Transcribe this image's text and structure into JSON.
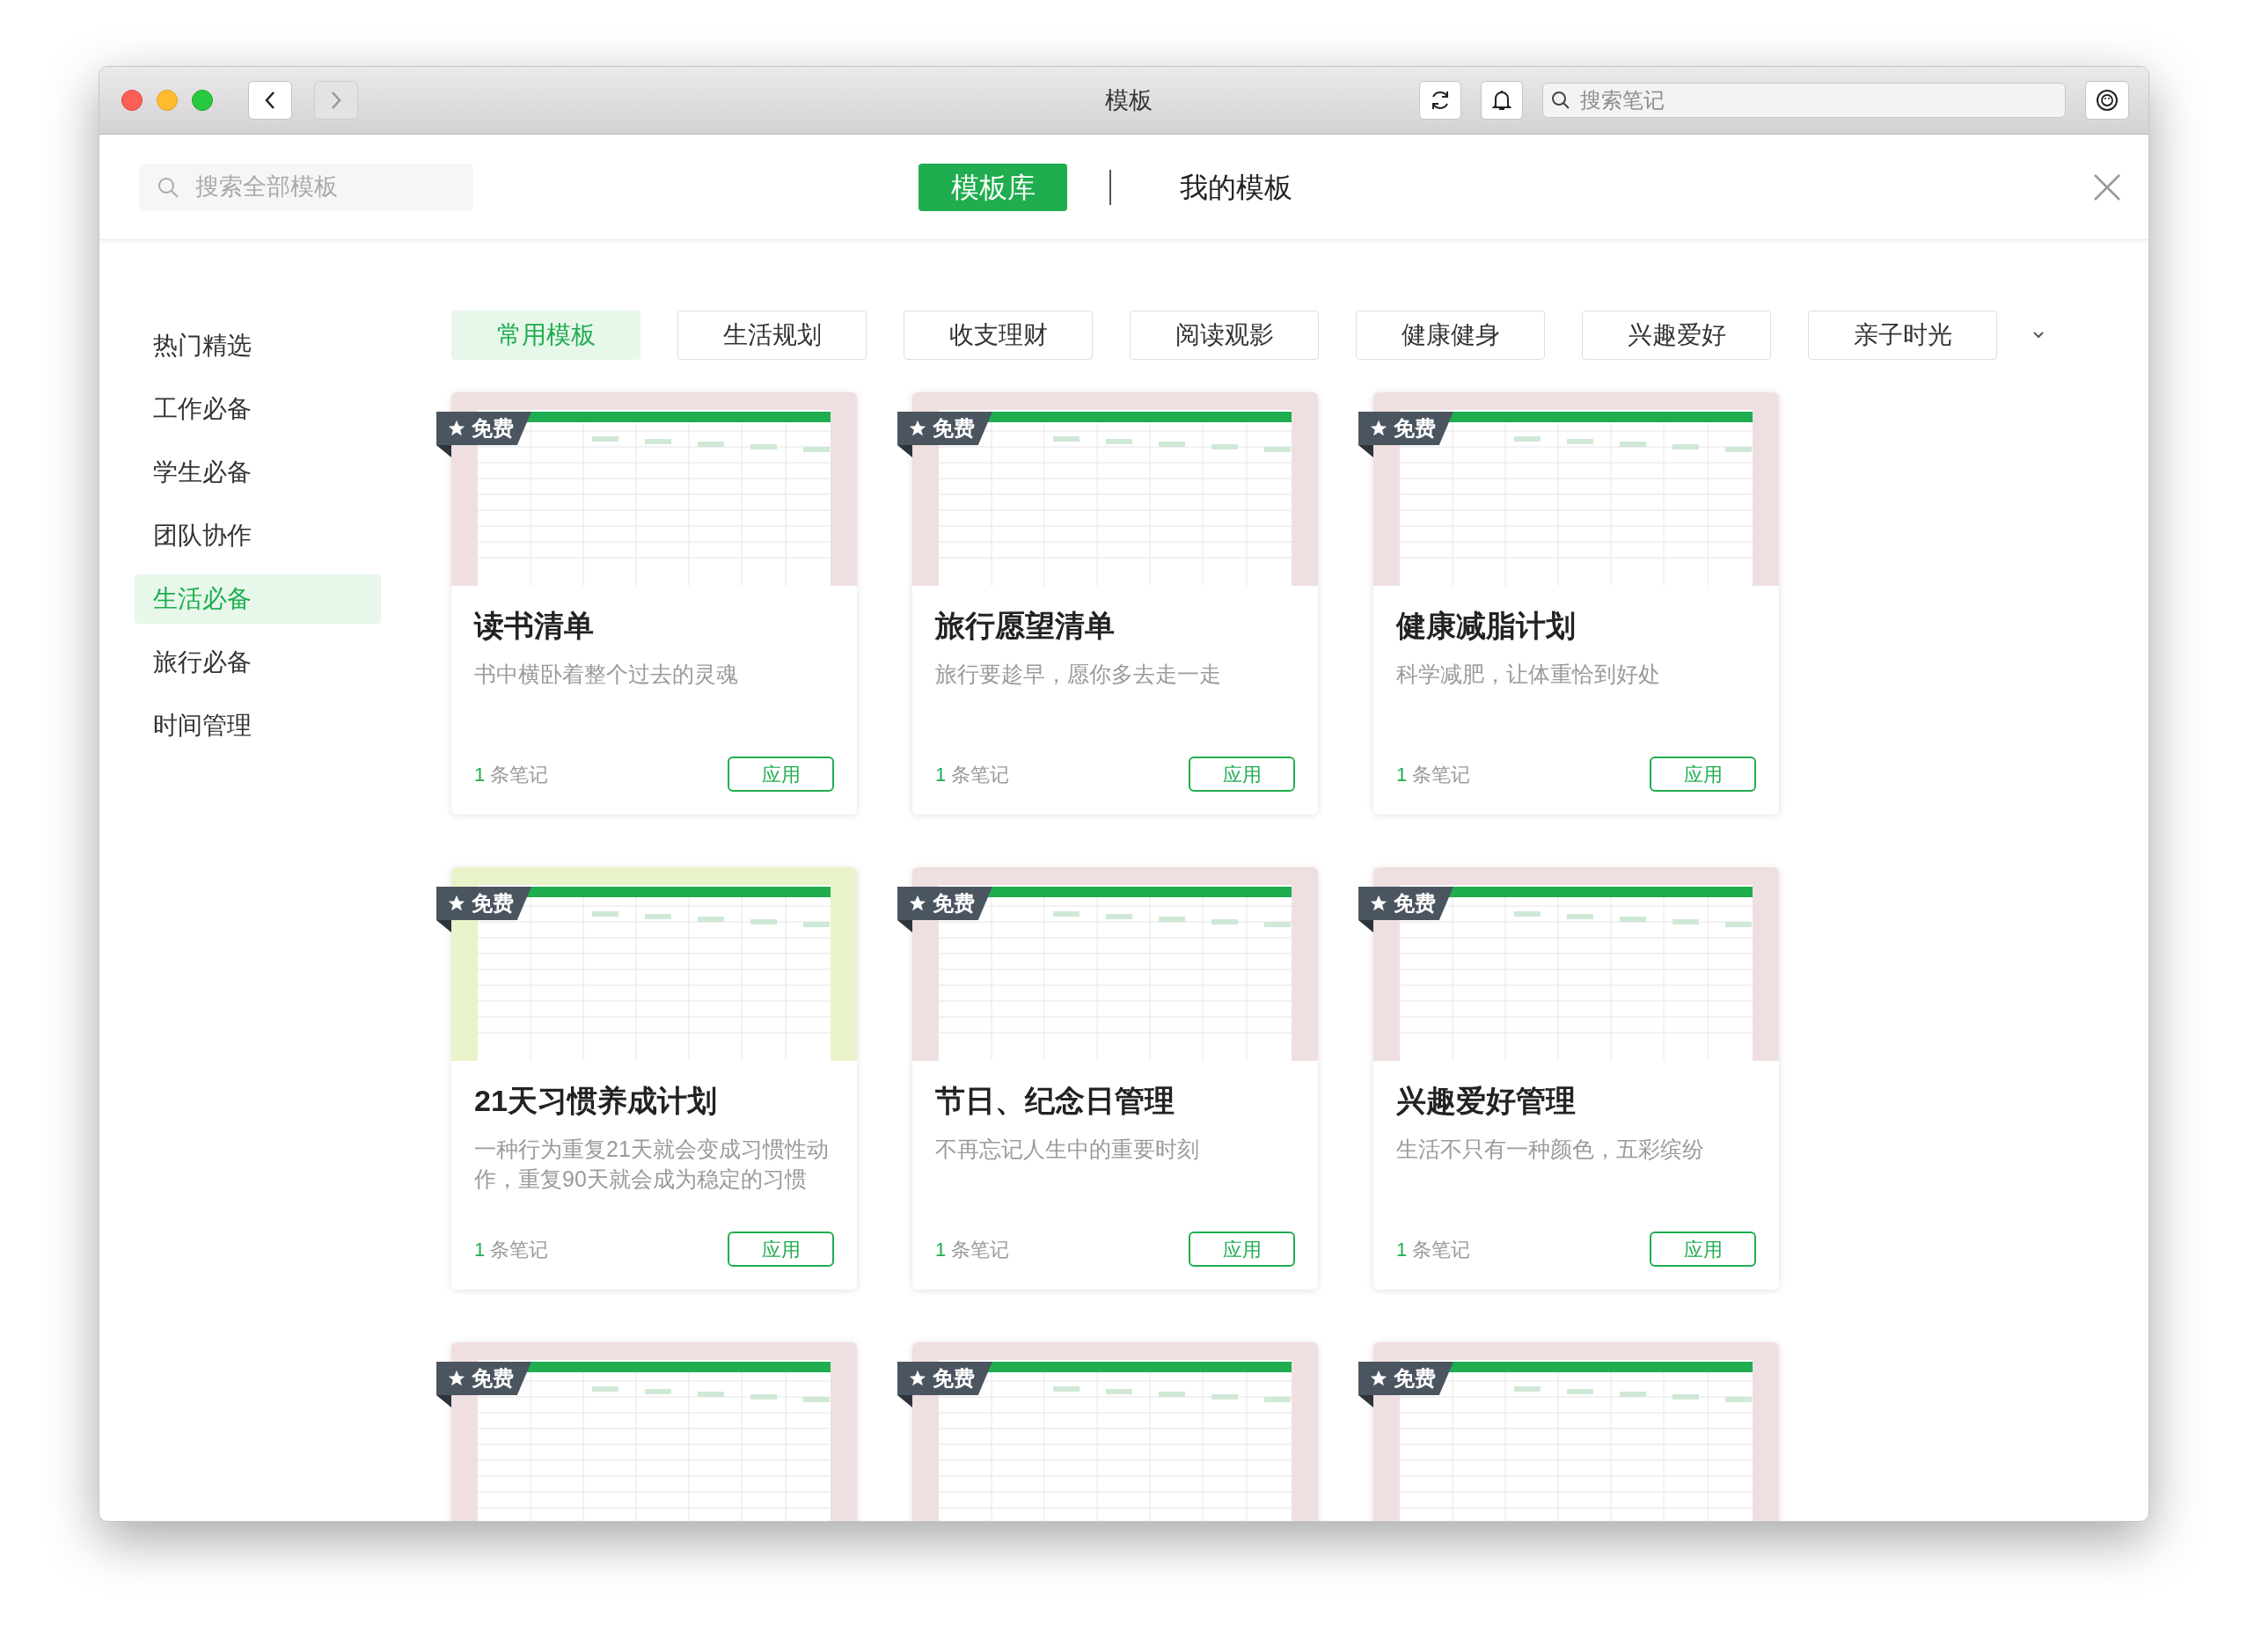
{
  "window": {
    "title": "模板"
  },
  "toolbar": {
    "search": {
      "placeholder": "搜索笔记"
    }
  },
  "header": {
    "search": {
      "placeholder": "搜索全部模板"
    },
    "tabs": [
      {
        "label": "模板库",
        "selected": true
      },
      {
        "label": "我的模板",
        "selected": false
      }
    ]
  },
  "sidebar": {
    "items": [
      {
        "label": "热门精选",
        "selected": false
      },
      {
        "label": "工作必备",
        "selected": false
      },
      {
        "label": "学生必备",
        "selected": false
      },
      {
        "label": "团队协作",
        "selected": false
      },
      {
        "label": "生活必备",
        "selected": true
      },
      {
        "label": "旅行必备",
        "selected": false
      },
      {
        "label": "时间管理",
        "selected": false
      }
    ]
  },
  "categories": [
    {
      "label": "常用模板",
      "selected": true
    },
    {
      "label": "生活规划",
      "selected": false
    },
    {
      "label": "收支理财",
      "selected": false
    },
    {
      "label": "阅读观影",
      "selected": false
    },
    {
      "label": "健康健身",
      "selected": false
    },
    {
      "label": "兴趣爱好",
      "selected": false
    },
    {
      "label": "亲子时光",
      "selected": false
    }
  ],
  "templates": [
    {
      "badge": "免费",
      "color": "#f0dfe0",
      "title": "读书清单",
      "description": "书中横卧着整个过去的灵魂",
      "count": "1",
      "count_unit": "条笔记",
      "button": "应用"
    },
    {
      "badge": "免费",
      "color": "#f0dfe0",
      "title": "旅行愿望清单",
      "description": "旅行要趁早，愿你多去走一走",
      "count": "1",
      "count_unit": "条笔记",
      "button": "应用"
    },
    {
      "badge": "免费",
      "color": "#f0dfe0",
      "title": "健康减脂计划",
      "description": "科学减肥，让体重恰到好处",
      "count": "1",
      "count_unit": "条笔记",
      "button": "应用"
    },
    {
      "badge": "免费",
      "color": "#e9f3c9",
      "title": "21天习惯养成计划",
      "description": "一种行为重复21天就会变成习惯性动作，重复90天就会成为稳定的习惯",
      "count": "1",
      "count_unit": "条笔记",
      "button": "应用"
    },
    {
      "badge": "免费",
      "color": "#f0dfe0",
      "title": "节日、纪念日管理",
      "description": "不再忘记人生中的重要时刻",
      "count": "1",
      "count_unit": "条笔记",
      "button": "应用"
    },
    {
      "badge": "免费",
      "color": "#f0dfe0",
      "title": "兴趣爱好管理",
      "description": "生活不只有一种颜色，五彩缤纷",
      "count": "1",
      "count_unit": "条笔记",
      "button": "应用"
    },
    {
      "badge": "免费",
      "color": "#f0dfe0"
    },
    {
      "badge": "免费",
      "color": "#f0dfe0"
    },
    {
      "badge": "免费",
      "color": "#f0dfe0"
    }
  ]
}
